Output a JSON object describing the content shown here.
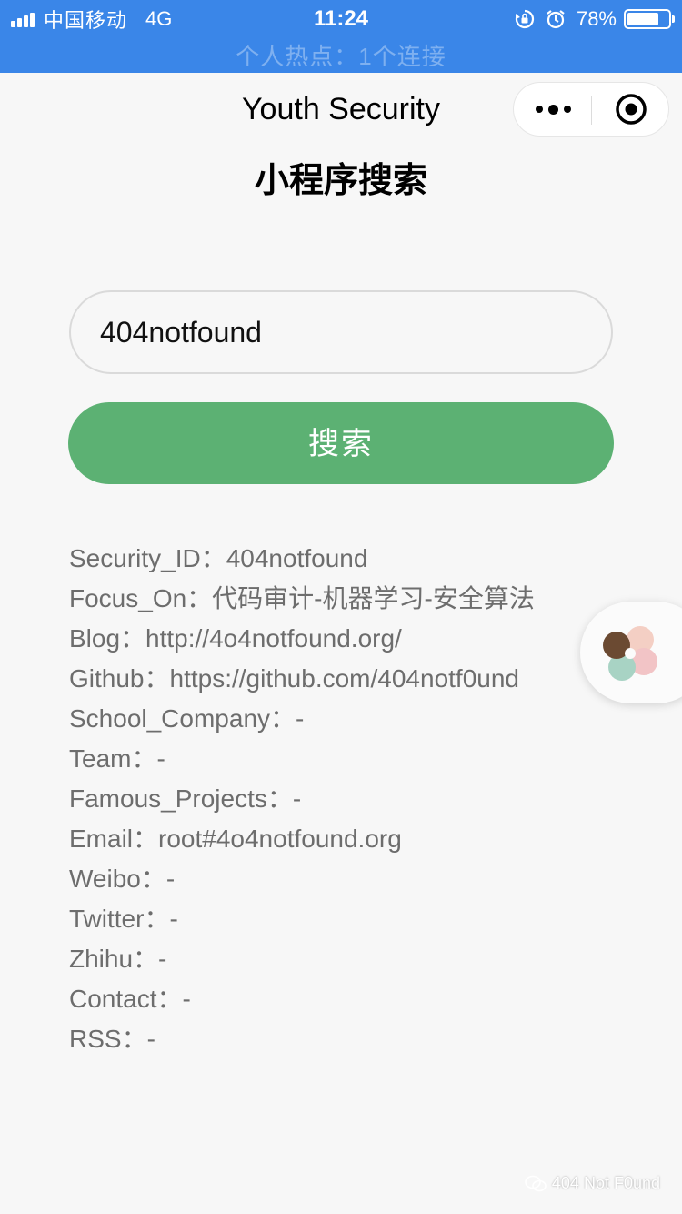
{
  "status_bar": {
    "carrier": "中国移动",
    "network": "4G",
    "time": "11:24",
    "battery": "78%",
    "battery_level": 0.78,
    "hotspot": "个人热点：1个连接",
    "background_color": "#3a86e8"
  },
  "nav": {
    "title": "Youth Security",
    "more_icon": "more-dots-icon",
    "close_icon": "target-circle-icon"
  },
  "page": {
    "title": "小程序搜索"
  },
  "search": {
    "value": "404notfound",
    "button_label": "搜索",
    "button_color": "#5cb173"
  },
  "info": [
    "Security_ID：404notfound",
    "Focus_On：代码审计-机器学习-安全算法",
    "Blog：http://4o4notfound.org/",
    "Github：https://github.com/404notf0und",
    "School_Company：-",
    "Team：-",
    "Famous_Projects：-",
    "Email：root#4o4notfound.org",
    "Weibo：-",
    "Twitter：-",
    "Zhihu：-",
    "Contact：-",
    "RSS：-"
  ],
  "watermark": {
    "text": "404 Not F0und",
    "icon": "wechat-icon"
  }
}
